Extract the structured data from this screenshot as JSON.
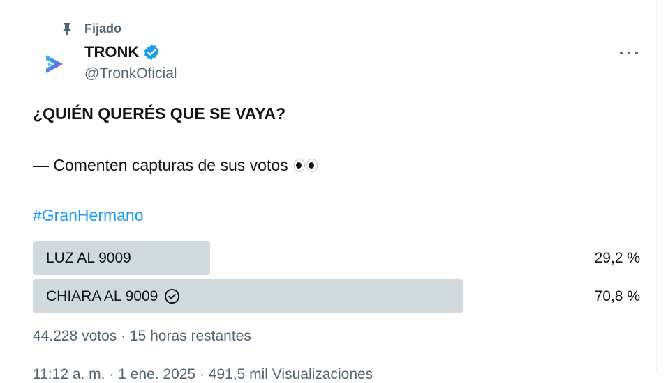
{
  "pinned": {
    "label": "Fijado",
    "icon": "pin-icon"
  },
  "author": {
    "name": "TRONK",
    "handle": "@TronkOficial",
    "verified_icon": "verified-badge-icon",
    "avatar_icon": "tronk-logo-icon"
  },
  "tweet": {
    "title": "¿QUIÉN QUERÉS QUE SE VAYA?",
    "line2": "— Comenten capturas de sus votos",
    "emoji_icon": "eyes-emoji-icon",
    "hashtag": "#GranHermano"
  },
  "poll": {
    "options": [
      {
        "label": "LUZ AL 9009",
        "percent_text": "29,2 %",
        "percent": 29.2,
        "winner": false
      },
      {
        "label": "CHIARA AL 9009",
        "percent_text": "70,8 %",
        "percent": 70.8,
        "winner": true
      }
    ],
    "summary": "44.228 votos · 15 horas restantes"
  },
  "footer_cut": "11:12 a. m. · 1 ene. 2025 · 491,5 mil Visualizaciones",
  "colors": {
    "accent": "#1d9bf0",
    "secondary": "#536471",
    "poll_fill": "#cfd9de"
  }
}
